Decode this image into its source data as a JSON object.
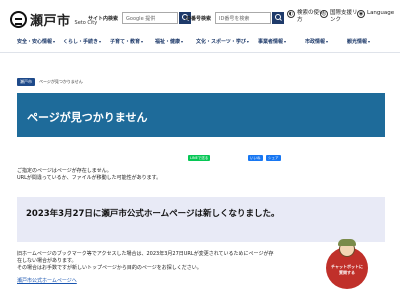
{
  "header": {
    "logo_text": "瀬戸市",
    "logo_sub": "Seto City",
    "site_search_label": "サイト内検索",
    "site_search_placeholder": "Google 提供",
    "id_search_label": "ID番号検索",
    "id_search_placeholder": "ID番号を検索",
    "util_reading_line1": "検索の使い",
    "util_reading_line2": "方",
    "util_intl_line1": "国際支援リ",
    "util_intl_line2": "ンク",
    "util_lang_line1": "Language",
    "util_lang_line2": "ge"
  },
  "nav": {
    "items": [
      "安全・安心情報",
      "くらし・手続き",
      "子育て・教育",
      "福祉・健康",
      "文化・スポーツ・学び",
      "事業者情報",
      "市政情報",
      "観光情報"
    ]
  },
  "breadcrumb": {
    "home": "瀬戸市",
    "current": "ページが見つかりません"
  },
  "page_title": "ページが見つかりません",
  "share": {
    "line": "LINEで送る",
    "like": "いいね",
    "share": "シェア"
  },
  "message": {
    "line1": "ご指定のページはページが存在しません。",
    "line2": "URLが間違っているか、ファイルが移動した可能性があります。"
  },
  "announcement": "2023年3月27日に瀬戸市公式ホームページは新しくなりました。",
  "notice": {
    "line1": "旧ホームページのブックマーク等でアクセスした場合は、2023年3月27日URLが変更されているためにページが存",
    "line2": "在しない場合があります。",
    "line3": "その場合はお手数ですが新しいトップページから目的のページをお探しください。"
  },
  "home_link": "瀬戸市公式ホームページへ",
  "chatbot": {
    "line1": "チャットボットに",
    "line2": "質問する"
  },
  "colors": {
    "title_bar": "#1e6b9a",
    "nav_text": "#1e3a6a",
    "announce_bg": "#e8eaf6",
    "chatbot": "#c0302a"
  }
}
